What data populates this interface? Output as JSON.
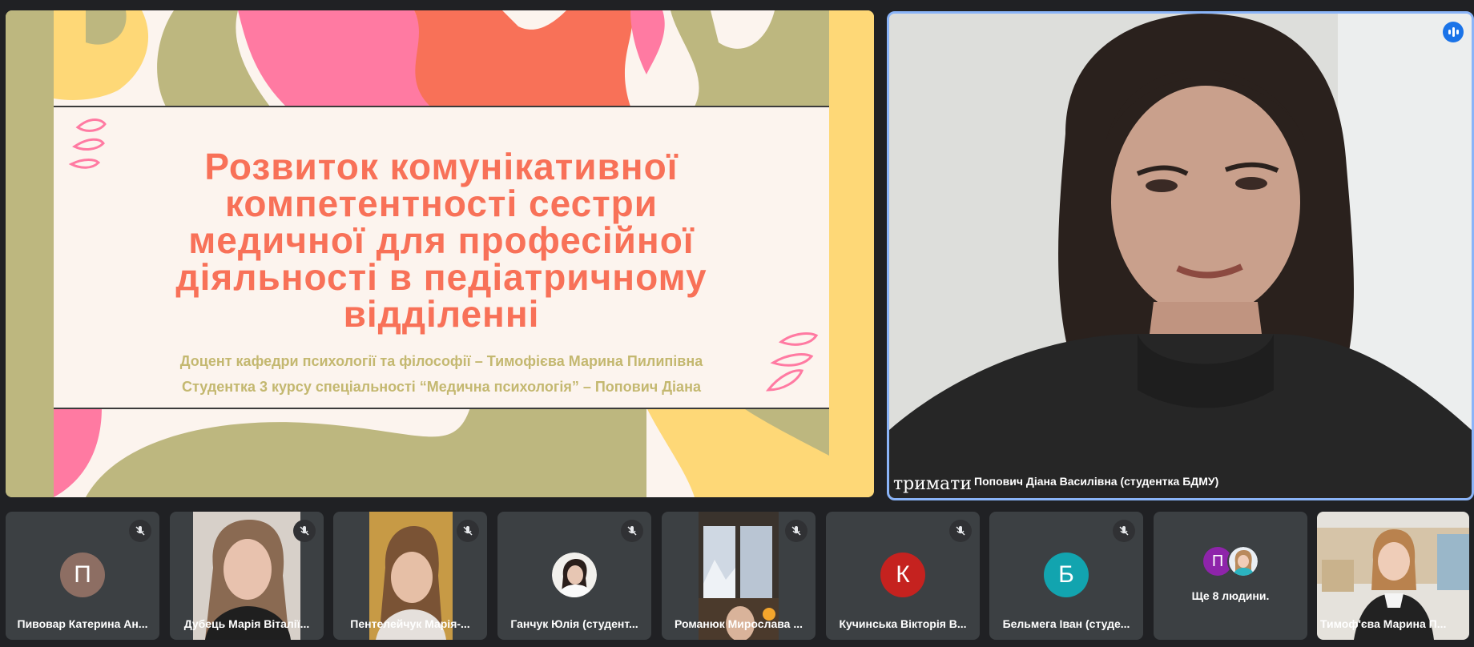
{
  "slide": {
    "title_lines": [
      "Розвиток комунікативної",
      "компетентності сестри",
      "медичної для професійної",
      "діяльності в педіатричному",
      "відділенні"
    ],
    "subtitle_1": "Доцент кафедри психології та філософії – Тимофієва Марина Пилипівна",
    "subtitle_2": "Студентка 3 курсу спеціальності  “Медична психологія”  – Попович Діана",
    "colors": {
      "coral": "#f87158",
      "pink": "#ff7aa2",
      "olive": "#bdb77f",
      "yellow": "#fed877",
      "cream": "#fcf4ee"
    }
  },
  "speaker": {
    "name": "Попович Діана Василівна (студентка БДМУ)",
    "overlay_text": "тримати",
    "indicator_icon": "speaking-indicator-icon"
  },
  "participants": [
    {
      "name": "Пивовар Катерина Ан...",
      "initial": "П",
      "avatar_color": "#8d6e63",
      "muted": true
    },
    {
      "name": "Дубець Марія Віталії...",
      "initial": "",
      "video": true,
      "muted": true
    },
    {
      "name": "Пентелейчук Марія-...",
      "initial": "",
      "video": true,
      "muted": true
    },
    {
      "name": "Ганчук Юлія (студент...",
      "initial": "",
      "photo": true,
      "muted": true
    },
    {
      "name": "Романюк Мирослава ...",
      "initial": "",
      "video": true,
      "muted": true
    },
    {
      "name": "Кучинська Вікторія В...",
      "initial": "К",
      "avatar_color": "#c5221f",
      "muted": true
    },
    {
      "name": "Бельмега Іван (студе...",
      "initial": "Б",
      "avatar_color": "#12a4af",
      "muted": true
    }
  ],
  "others": {
    "label": "Ще 8 людини.",
    "initial": "П",
    "avatar_color": "#8e24aa"
  },
  "self": {
    "name": "Тимоф'єва Марина П..."
  },
  "accent": "#8ab4f8"
}
